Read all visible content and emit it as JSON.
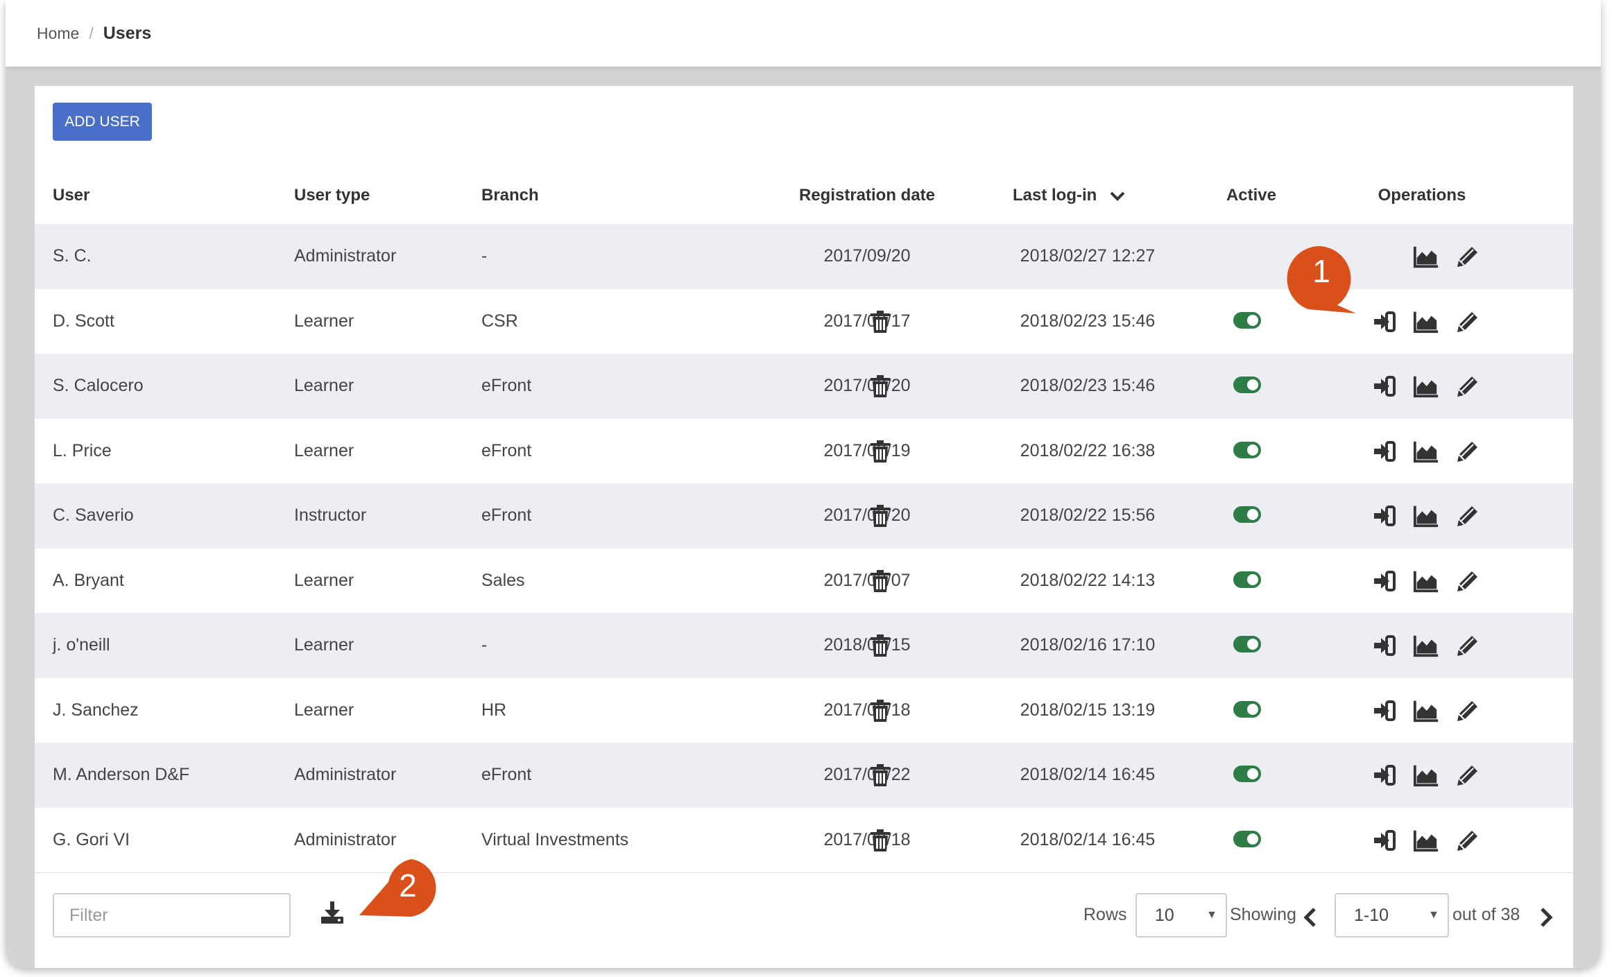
{
  "breadcrumb": {
    "home": "Home",
    "separator": "/",
    "current": "Users"
  },
  "toolbar": {
    "add_user_label": "ADD USER"
  },
  "table": {
    "headers": {
      "user": "User",
      "user_type": "User type",
      "branch": "Branch",
      "registration_date": "Registration date",
      "last_login": "Last log-in",
      "active": "Active",
      "operations": "Operations"
    },
    "sort": {
      "column": "last_login",
      "direction": "descending",
      "icon": "chevron-down-icon"
    },
    "rows": [
      {
        "user": "S. C.",
        "user_type": "Administrator",
        "branch": "-",
        "registration_date": "2017/09/20",
        "last_login": "2018/02/27 12:27",
        "active": null,
        "operations": [
          "stats",
          "edit"
        ]
      },
      {
        "user": "D. Scott",
        "user_type": "Learner",
        "branch": "CSR",
        "registration_date": "2017/08/17",
        "last_login": "2018/02/23 15:46",
        "active": true,
        "operations": [
          "login",
          "stats",
          "edit",
          "delete"
        ]
      },
      {
        "user": "S. Calocero",
        "user_type": "Learner",
        "branch": "eFront",
        "registration_date": "2017/09/20",
        "last_login": "2018/02/23 15:46",
        "active": true,
        "operations": [
          "login",
          "stats",
          "edit",
          "delete"
        ]
      },
      {
        "user": "L. Price",
        "user_type": "Learner",
        "branch": "eFront",
        "registration_date": "2017/08/19",
        "last_login": "2018/02/22 16:38",
        "active": true,
        "operations": [
          "login",
          "stats",
          "edit",
          "delete"
        ]
      },
      {
        "user": "C. Saverio",
        "user_type": "Instructor",
        "branch": "eFront",
        "registration_date": "2017/09/20",
        "last_login": "2018/02/22 15:56",
        "active": true,
        "operations": [
          "login",
          "stats",
          "edit",
          "delete"
        ]
      },
      {
        "user": "A. Bryant",
        "user_type": "Learner",
        "branch": "Sales",
        "registration_date": "2017/08/07",
        "last_login": "2018/02/22 14:13",
        "active": true,
        "operations": [
          "login",
          "stats",
          "edit",
          "delete"
        ]
      },
      {
        "user": "j. o'neill",
        "user_type": "Learner",
        "branch": "-",
        "registration_date": "2018/02/15",
        "last_login": "2018/02/16 17:10",
        "active": true,
        "operations": [
          "login",
          "stats",
          "edit",
          "delete"
        ]
      },
      {
        "user": "J. Sanchez",
        "user_type": "Learner",
        "branch": "HR",
        "registration_date": "2017/08/18",
        "last_login": "2018/02/15 13:19",
        "active": true,
        "operations": [
          "login",
          "stats",
          "edit",
          "delete"
        ]
      },
      {
        "user": "M. Anderson D&F",
        "user_type": "Administrator",
        "branch": "eFront",
        "registration_date": "2017/07/22",
        "last_login": "2018/02/14 16:45",
        "active": true,
        "operations": [
          "login",
          "stats",
          "edit",
          "delete"
        ]
      },
      {
        "user": "G. Gori VI",
        "user_type": "Administrator",
        "branch": "Virtual Investments",
        "registration_date": "2017/08/18",
        "last_login": "2018/02/14 16:45",
        "active": true,
        "operations": [
          "login",
          "stats",
          "edit",
          "delete"
        ]
      }
    ]
  },
  "footer": {
    "filter_placeholder": "Filter",
    "download_icon": "download-icon",
    "rows_label": "Rows",
    "rows_value": "10",
    "showing_label": "Showing",
    "range_value": "1-10",
    "out_of": "out of 38"
  },
  "callouts": [
    {
      "number": "1"
    },
    {
      "number": "2"
    }
  ],
  "colors": {
    "add_button": "#4a6fc8",
    "toggle_on": "#2e7d46",
    "row_alt": "#eceef3",
    "callout": "#d9501b",
    "frame": "#d4d4d4"
  }
}
